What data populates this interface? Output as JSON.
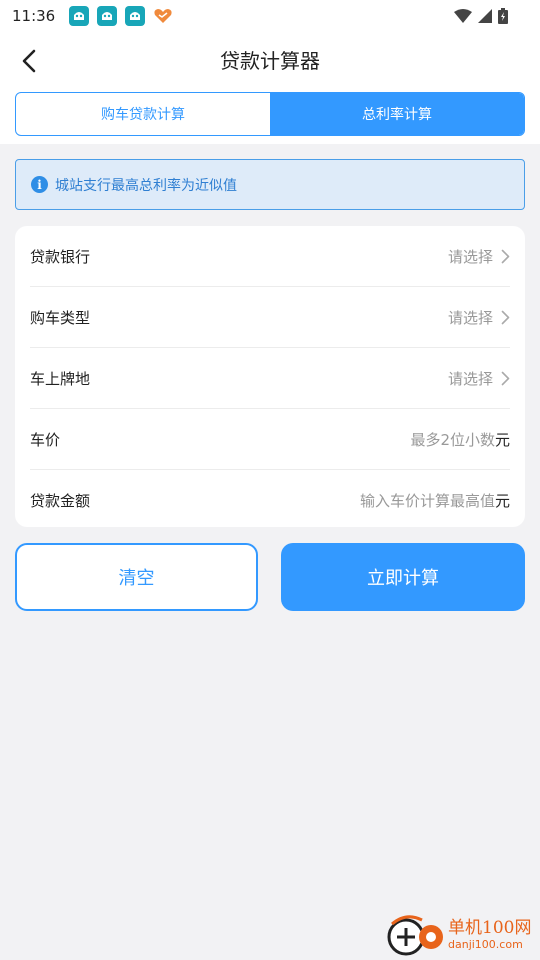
{
  "status_bar": {
    "time": "11:36"
  },
  "header": {
    "title": "贷款计算器"
  },
  "tabs": [
    {
      "label": "购车贷款计算",
      "active": false
    },
    {
      "label": "总利率计算",
      "active": true
    }
  ],
  "info": {
    "text": "城站支行最高总利率为近似值"
  },
  "form": {
    "rows": [
      {
        "label": "贷款银行",
        "value": "请选择"
      },
      {
        "label": "购车类型",
        "value": "请选择"
      },
      {
        "label": "车上牌地",
        "value": "请选择"
      },
      {
        "label": "车价",
        "placeholder": "最多2位小数",
        "unit": "元"
      },
      {
        "label": "贷款金额",
        "placeholder": "输入车价计算最高值",
        "unit": "元"
      }
    ]
  },
  "buttons": {
    "clear_label": "清空",
    "calc_label": "立即计算"
  },
  "watermark": {
    "cn": "单机100网",
    "en": "danji100.com"
  },
  "colors": {
    "accent": "#3399ff",
    "info_bg": "#deebf9",
    "background": "#f2f2f4"
  }
}
